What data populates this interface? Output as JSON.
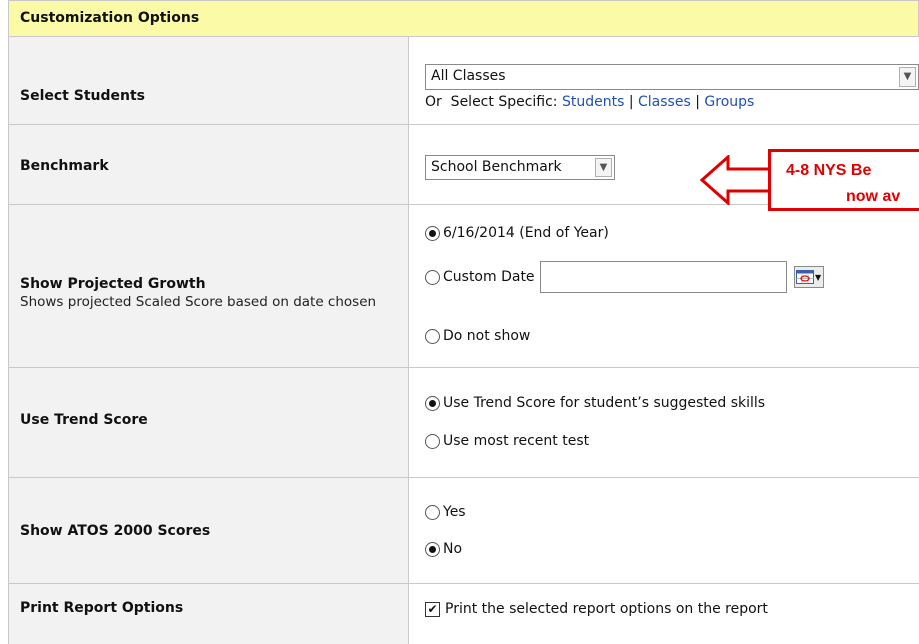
{
  "header": {
    "title": "Customization Options"
  },
  "rows": {
    "select_students": {
      "label": "Select Students",
      "dropdown_value": "All Classes",
      "or_select_text": "Or  Select Specific:",
      "links": [
        "Students",
        "Classes",
        "Groups"
      ],
      "separator": "|"
    },
    "benchmark": {
      "label": "Benchmark",
      "dropdown_value": "School Benchmark"
    },
    "projected_growth": {
      "label": "Show Projected Growth",
      "description": "Shows projected Scaled Score based on date chosen",
      "options": [
        "6/16/2014 (End of Year)",
        "Custom Date",
        "Do not show"
      ],
      "selected_index": 0,
      "custom_date_value": ""
    },
    "trend_score": {
      "label": "Use Trend Score",
      "options": [
        "Use Trend Score for student’s suggested skills",
        "Use most recent test"
      ],
      "selected_index": 0
    },
    "atos": {
      "label": "Show ATOS 2000 Scores",
      "options": [
        "Yes",
        "No"
      ],
      "selected_index": 1
    },
    "print_options": {
      "label": "Print Report Options",
      "checkbox_label": "Print the selected report options on the report",
      "checked": true
    }
  },
  "callout": {
    "line1": "4-8 NYS Be",
    "line2": "now av",
    "color": "#e00000"
  },
  "colors": {
    "header_bg": "#fbfaa6",
    "label_bg": "#f2f2f2",
    "link": "#1f4fb5"
  }
}
